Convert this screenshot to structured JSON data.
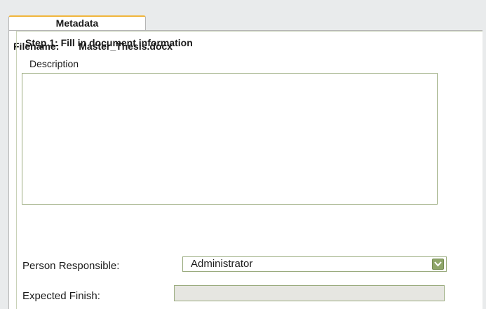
{
  "tabs": [
    {
      "label": "Metadata",
      "active": true
    }
  ],
  "filename": {
    "label": "Filename:",
    "value": "Master_Thesis.docx"
  },
  "step": {
    "title": "Step 1: Fill in document information"
  },
  "description": {
    "label": "Description",
    "value": ""
  },
  "person_responsible": {
    "label": "Person Responsible:",
    "selected": "Administrator",
    "icon": "chevron-down-icon"
  },
  "expected_finish": {
    "label": "Expected Finish:",
    "value": ""
  },
  "colors": {
    "tab_accent": "#f1b53b",
    "field_border": "#9aab7e",
    "dropdown_button": "#8fa66a",
    "disabled_field": "#e6e6e1"
  }
}
